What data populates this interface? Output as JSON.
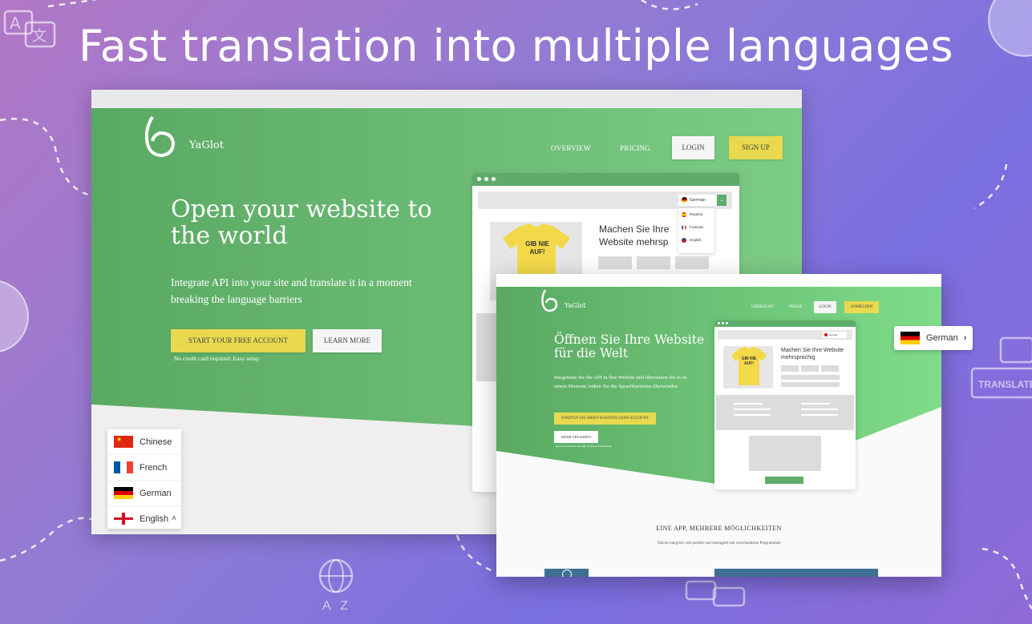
{
  "headline": "Fast translation into multiple languages",
  "decor": {
    "translate_label": "TRANSLATE",
    "az_label": "A Z"
  },
  "english_site": {
    "brand": "YaGlot",
    "nav": {
      "overview": "OVERVIEW",
      "pricing": "PRICING",
      "login": "LOGIN",
      "signup": "SIGN UP"
    },
    "hero_title": "Open your website to the world",
    "hero_subtitle": "Integrate API into your site and translate it in a moment breaking the language barriers",
    "cta_primary": "START YOUR FREE ACCOUNT",
    "cta_secondary": "LEARN MORE",
    "cta_note": "No credit card required. Easy setup.",
    "mock": {
      "selected_language": "German",
      "dropdown_options": [
        "Español",
        "Français",
        "English"
      ],
      "shirt_text": "GIB NIE AUF!",
      "text_line": "Machen Sie Ihre Website mehrsp"
    },
    "language_switcher": [
      "Chinese",
      "French",
      "German",
      "English"
    ]
  },
  "german_site": {
    "brand": "YaGlot",
    "nav": {
      "overview": "ÜBERSICHT",
      "pricing": "PREISE",
      "login": "LOGIN",
      "signup": "ANMELDEN"
    },
    "hero_title": "Öffnen Sie Ihre Website für die Welt",
    "hero_subtitle": "Integrieren Sie die API in Ihre Website und übersetzen Sie es in einem Moment, indem Sie die Sprachbarrieren überwinden",
    "cta_primary": "STARTEN SIE IHREN KOSTENLOSEN ACCOUNT",
    "cta_secondary": "MEHR ERFAHREN",
    "cta_note": "Keine Kreditkarte benötigt. Einfache Einrichtung.",
    "mock": {
      "selected_language": "German",
      "shirt_text": "GIB NIE AUF!",
      "text_line": "Machen Sie Ihre Website mehrsprachig"
    },
    "section_title": "EINE APP, MEHRERE MÖGLICHKEITEN",
    "section_text": "YaGlot integriert sich perfekt und interagiert mit verschiedenen Programmen"
  },
  "floating_language": "German",
  "colors": {
    "green": "#5fae68",
    "yellow": "#e8d94e",
    "bg_purple": "#8c7ad6"
  }
}
